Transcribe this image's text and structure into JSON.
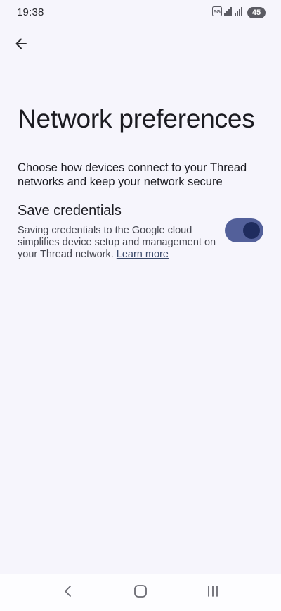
{
  "status_bar": {
    "time": "19:38",
    "battery": "45",
    "network_label": "5G",
    "icons": [
      "5g-icon",
      "signal-icon",
      "signal-icon",
      "battery-icon"
    ]
  },
  "header": {
    "back_icon": "arrow-left-icon"
  },
  "page": {
    "title": "Network preferences",
    "description": "Choose how devices connect to your Thread networks and keep your network secure"
  },
  "setting": {
    "title": "Save credentials",
    "subtitle": "Saving credentials to the Google cloud simplifies device setup and management on your Thread network.",
    "link": "Learn more",
    "enabled": true
  },
  "nav": {
    "back_icon": "chevron-left-icon",
    "home_icon": "home-icon",
    "recents_icon": "recents-icon"
  },
  "colors": {
    "background": "#f6f5fc",
    "toggle_track": "#53609a",
    "toggle_knob": "#1f2c5e"
  }
}
